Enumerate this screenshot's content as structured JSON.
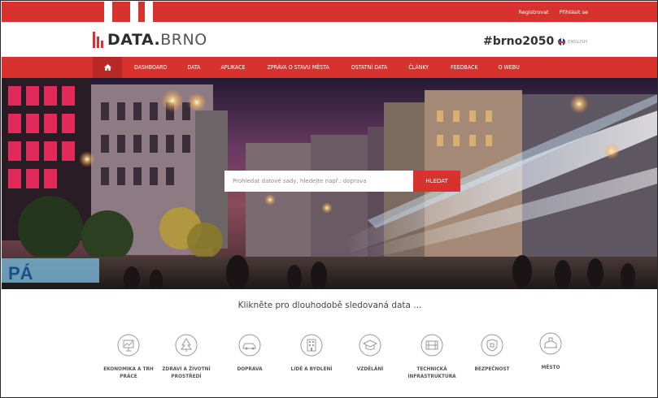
{
  "topbar": {
    "register": "Registrovat",
    "login": "Přihlásit se"
  },
  "header": {
    "logo_bold": "DATA",
    "logo_dot": ".",
    "logo_light": "BRNO",
    "hashtag": "#brno2050",
    "language": "ENGLISH"
  },
  "nav": {
    "items": [
      {
        "label": "DASHBOARD"
      },
      {
        "label": "DATA"
      },
      {
        "label": "APLIKACE"
      },
      {
        "label": "ZPRÁVA O STAVU MĚSTA"
      },
      {
        "label": "OSTATNÍ DATA"
      },
      {
        "label": "ČLÁNKY"
      },
      {
        "label": "FEEDBACK"
      },
      {
        "label": "O WEBU"
      }
    ]
  },
  "hero": {
    "search_placeholder": "Prohledat datové sady, hledejte např.: doprava",
    "search_button": "HLEDAT"
  },
  "main": {
    "lead": "Klikněte pro dlouhodobě sledovaná data ...",
    "categories": [
      {
        "line1": "EKONOMIKA A TRH",
        "line2": "PRÁCE",
        "icon": "chart-icon"
      },
      {
        "line1": "ZDRAVÍ A ŽIVOTNÍ",
        "line2": "PROSTŘEDÍ",
        "icon": "tree-icon"
      },
      {
        "line1": "DOPRAVA",
        "line2": "",
        "icon": "car-icon"
      },
      {
        "line1": "LIDÉ A BYDLENÍ",
        "line2": "",
        "icon": "building-icon"
      },
      {
        "line1": "VZDĚLÁNÍ",
        "line2": "",
        "icon": "graduation-cap-icon"
      },
      {
        "line1": "TECHNICKÁ",
        "line2": "INFRASTRUKTURA",
        "icon": "infrastructure-icon"
      },
      {
        "line1": "BEZPEČNOST",
        "line2": "",
        "icon": "shield-icon"
      },
      {
        "line1": "MĚSTO",
        "line2": "",
        "icon": "city-icon"
      }
    ]
  },
  "colors": {
    "brand_red": "#d8322e",
    "dark_red": "#b82824"
  }
}
